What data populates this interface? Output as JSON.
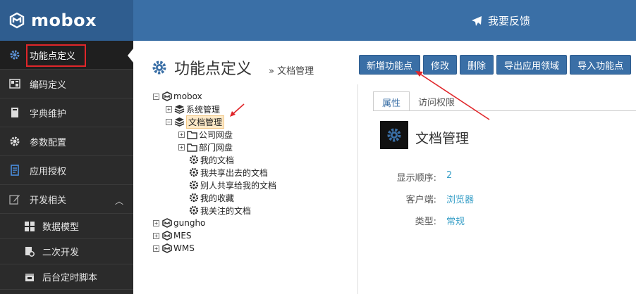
{
  "app": {
    "logo_text": "mobox",
    "feedback_label": "我要反馈"
  },
  "sidebar": {
    "items": [
      {
        "label": "功能点定义",
        "icon": "gear-icon"
      },
      {
        "label": "编码定义",
        "icon": "barcode-icon"
      },
      {
        "label": "字典维护",
        "icon": "book-icon"
      },
      {
        "label": "参数配置",
        "icon": "gear-icon"
      },
      {
        "label": "应用授权",
        "icon": "document-icon"
      },
      {
        "label": "开发相关",
        "icon": "edit-icon"
      }
    ],
    "sub_items": [
      {
        "label": "数据模型",
        "icon": "grid-icon"
      },
      {
        "label": "二次开发",
        "icon": "doc-gear-icon"
      },
      {
        "label": "后台定时脚本",
        "icon": "calendar-icon"
      }
    ]
  },
  "page": {
    "title": "功能点定义",
    "breadcrumb": "» 文档管理"
  },
  "toolbar": {
    "buttons": [
      "新增功能点",
      "修改",
      "删除",
      "导出应用领域",
      "导入功能点"
    ]
  },
  "tree": {
    "root1": "mobox",
    "sys": "系统管理",
    "doc": "文档管理",
    "company_drive": "公司网盘",
    "dept_drive": "部门网盘",
    "my_docs": "我的文档",
    "my_shared": "我共享出去的文档",
    "shared_to_me": "别人共享给我的文档",
    "my_fav": "我的收藏",
    "my_follow": "我关注的文档",
    "root2": "gungho",
    "root3": "MES",
    "root4": "WMS"
  },
  "detail": {
    "tabs": [
      "属性",
      "访问权限"
    ],
    "name": "文档管理",
    "props": [
      {
        "k": "显示顺序:",
        "v": "2"
      },
      {
        "k": "客户端:",
        "v": "浏览器"
      },
      {
        "k": "类型:",
        "v": "常规"
      }
    ]
  },
  "colors": {
    "accent": "#3a6fa6",
    "sidebar": "#2b2b2b",
    "annotation": "#e0262a",
    "link": "#3aa0c8"
  }
}
